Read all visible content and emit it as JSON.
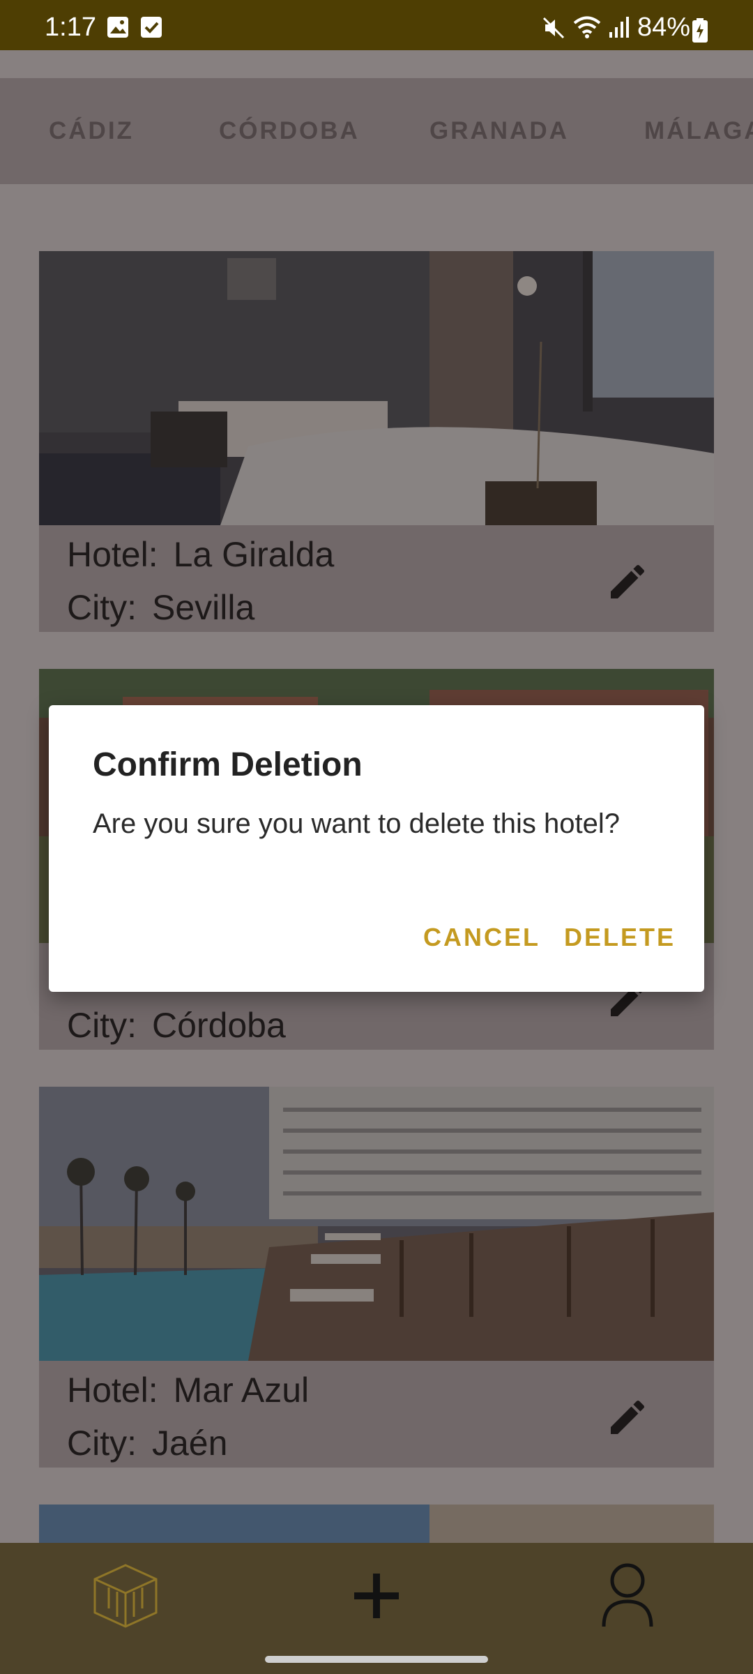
{
  "status_bar": {
    "time": "1:17",
    "battery": "84%",
    "icons": [
      "gallery-icon",
      "check-icon",
      "mute-icon",
      "wifi-icon",
      "signal-icon",
      "battery-charging-icon"
    ]
  },
  "tabs": [
    {
      "label": "CÁDIZ"
    },
    {
      "label": "CÓRDOBA"
    },
    {
      "label": "GRANADA"
    },
    {
      "label": "MÁLAGA"
    }
  ],
  "labels": {
    "hotel": "Hotel:",
    "city": "City:"
  },
  "cards": [
    {
      "hotel": "La Giralda",
      "city": "Sevilla"
    },
    {
      "hotel": "",
      "city": "Córdoba"
    },
    {
      "hotel": "Mar Azul",
      "city": "Jaén"
    }
  ],
  "dialog": {
    "title": "Confirm Deletion",
    "message": "Are you sure you want to delete this hotel?",
    "cancel": "CANCEL",
    "delete": "DELETE"
  },
  "bottom_nav": {
    "items": [
      "hotel-logo-icon",
      "add-icon",
      "profile-icon"
    ]
  },
  "colors": {
    "accent": "#c49a20",
    "status_bar": "#4e3e03",
    "bottom_nav": "#4e4329"
  }
}
